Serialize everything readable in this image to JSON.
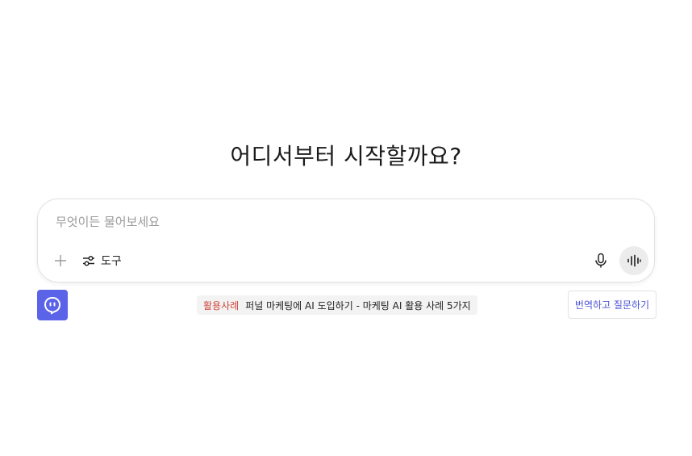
{
  "heading": "어디서부터 시작할까요?",
  "composer": {
    "placeholder": "무엇이든 물어보세요",
    "value": "",
    "tools_label": "도구",
    "icons": {
      "add": "plus-icon",
      "tools": "sliders-icon",
      "mic": "microphone-icon",
      "voice": "voice-wave-icon"
    }
  },
  "assistant_icon": "assistant-face-icon",
  "promo": {
    "tag": "활용사례",
    "text": "퍼널 마케팅에 AI 도입하기 - 마케팅 AI 활용 사례 5가지"
  },
  "translate_button": "번역하고 질문하기",
  "colors": {
    "accent": "#5b63e8",
    "promo_tag": "#d1453b",
    "translate_text": "#4a52d6"
  }
}
